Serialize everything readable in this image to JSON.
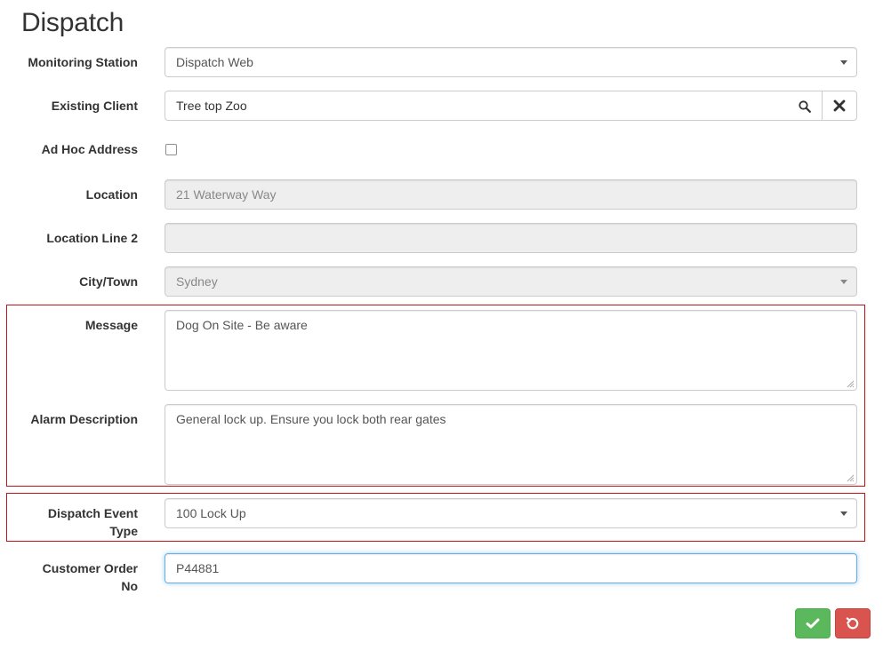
{
  "page": {
    "title": "Dispatch"
  },
  "form": {
    "monitoring_station": {
      "label": "Monitoring Station",
      "value": "Dispatch Web"
    },
    "existing_client": {
      "label": "Existing Client",
      "value": "Tree top Zoo"
    },
    "ad_hoc_address": {
      "label": "Ad Hoc Address",
      "checked": false
    },
    "location": {
      "label": "Location",
      "value": "21 Waterway Way"
    },
    "location_line_2": {
      "label": "Location Line 2",
      "value": ""
    },
    "city_town": {
      "label": "City/Town",
      "value": "Sydney"
    },
    "message": {
      "label": "Message",
      "value": "Dog On Site - Be aware"
    },
    "alarm_description": {
      "label": "Alarm Description",
      "value": "General lock up. Ensure you lock both rear gates"
    },
    "dispatch_event_type": {
      "label_line1": "Dispatch Event",
      "label_line2": "Type",
      "value": "100 Lock Up"
    },
    "customer_order_no": {
      "label_line1": "Customer Order",
      "label_line2": "No",
      "value": "P44881"
    }
  },
  "colors": {
    "highlight_border": "#c0141a",
    "save_button": "#5cb85c",
    "reset_button": "#d9534f",
    "focus_border": "#66afe9"
  },
  "icons": {
    "search": "search-icon",
    "clear": "close-icon",
    "save": "check-icon",
    "reset": "undo-icon"
  }
}
